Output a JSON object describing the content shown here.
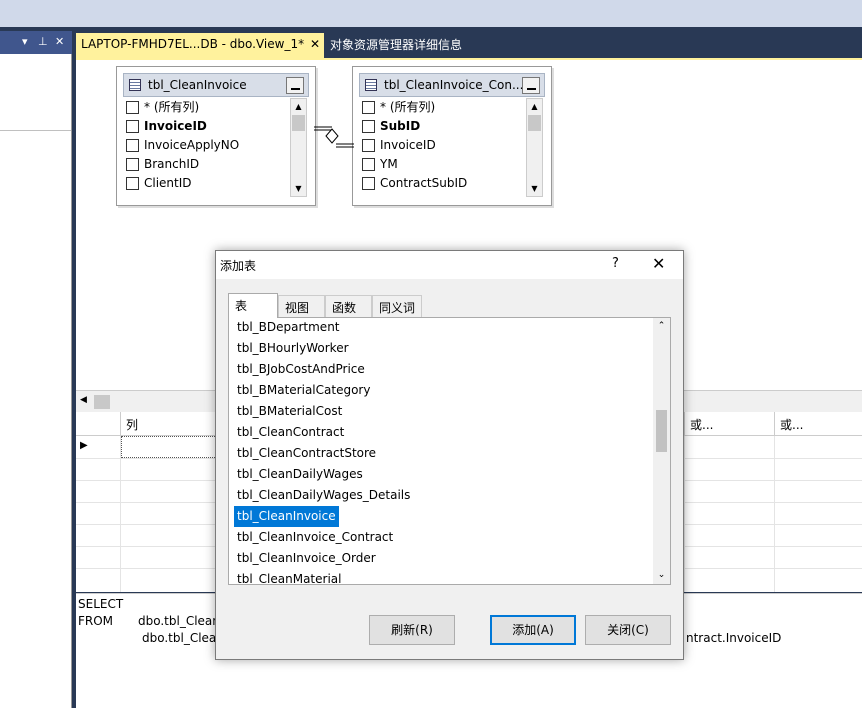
{
  "window": {
    "document_tab": "LAPTOP-FMHD7EL...DB - dbo.View_1*",
    "document_tab_close": "✕",
    "second_tab": "对象资源管理器详细信息",
    "panel_dropdown": "▾",
    "panel_pin": "⊥",
    "panel_close": "✕"
  },
  "diagram": {
    "tables": [
      {
        "title": "tbl_CleanInvoice",
        "rows": [
          {
            "label": "* (所有列)",
            "bold": false
          },
          {
            "label": "InvoiceID",
            "bold": true
          },
          {
            "label": "InvoiceApplyNO",
            "bold": false
          },
          {
            "label": "BranchID",
            "bold": false
          },
          {
            "label": "ClientID",
            "bold": false
          }
        ]
      },
      {
        "title": "tbl_CleanInvoice_Con...",
        "rows": [
          {
            "label": "* (所有列)",
            "bold": false
          },
          {
            "label": "SubID",
            "bold": true
          },
          {
            "label": "InvoiceID",
            "bold": false
          },
          {
            "label": "YM",
            "bold": false
          },
          {
            "label": "ContractSubID",
            "bold": false
          }
        ]
      }
    ]
  },
  "grid": {
    "headers": [
      "列",
      "或...",
      "或..."
    ]
  },
  "sql": {
    "line1": "SELECT",
    "line2_kw": "FROM",
    "line2_rest": "dbo.tbl_Clean",
    "line3": "dbo.tbl_Clea",
    "line3_tail": "ntract.InvoiceID"
  },
  "dialog": {
    "title": "添加表",
    "help": "?",
    "close": "✕",
    "tabs": [
      "表",
      "视图",
      "函数",
      "同义词"
    ],
    "items": [
      "tbl_BDepartment",
      "tbl_BHourlyWorker",
      "tbl_BJobCostAndPrice",
      "tbl_BMaterialCategory",
      "tbl_BMaterialCost",
      "tbl_CleanContract",
      "tbl_CleanContractStore",
      "tbl_CleanDailyWages",
      "tbl_CleanDailyWages_Details",
      "tbl_CleanInvoice",
      "tbl_CleanInvoice_Contract",
      "tbl_CleanInvoice_Order",
      "tbl_CleanMaterial"
    ],
    "selected_index": 9,
    "buttons": {
      "refresh": "刷新(R)",
      "add": "添加(A)",
      "close": "关闭(C)"
    }
  }
}
